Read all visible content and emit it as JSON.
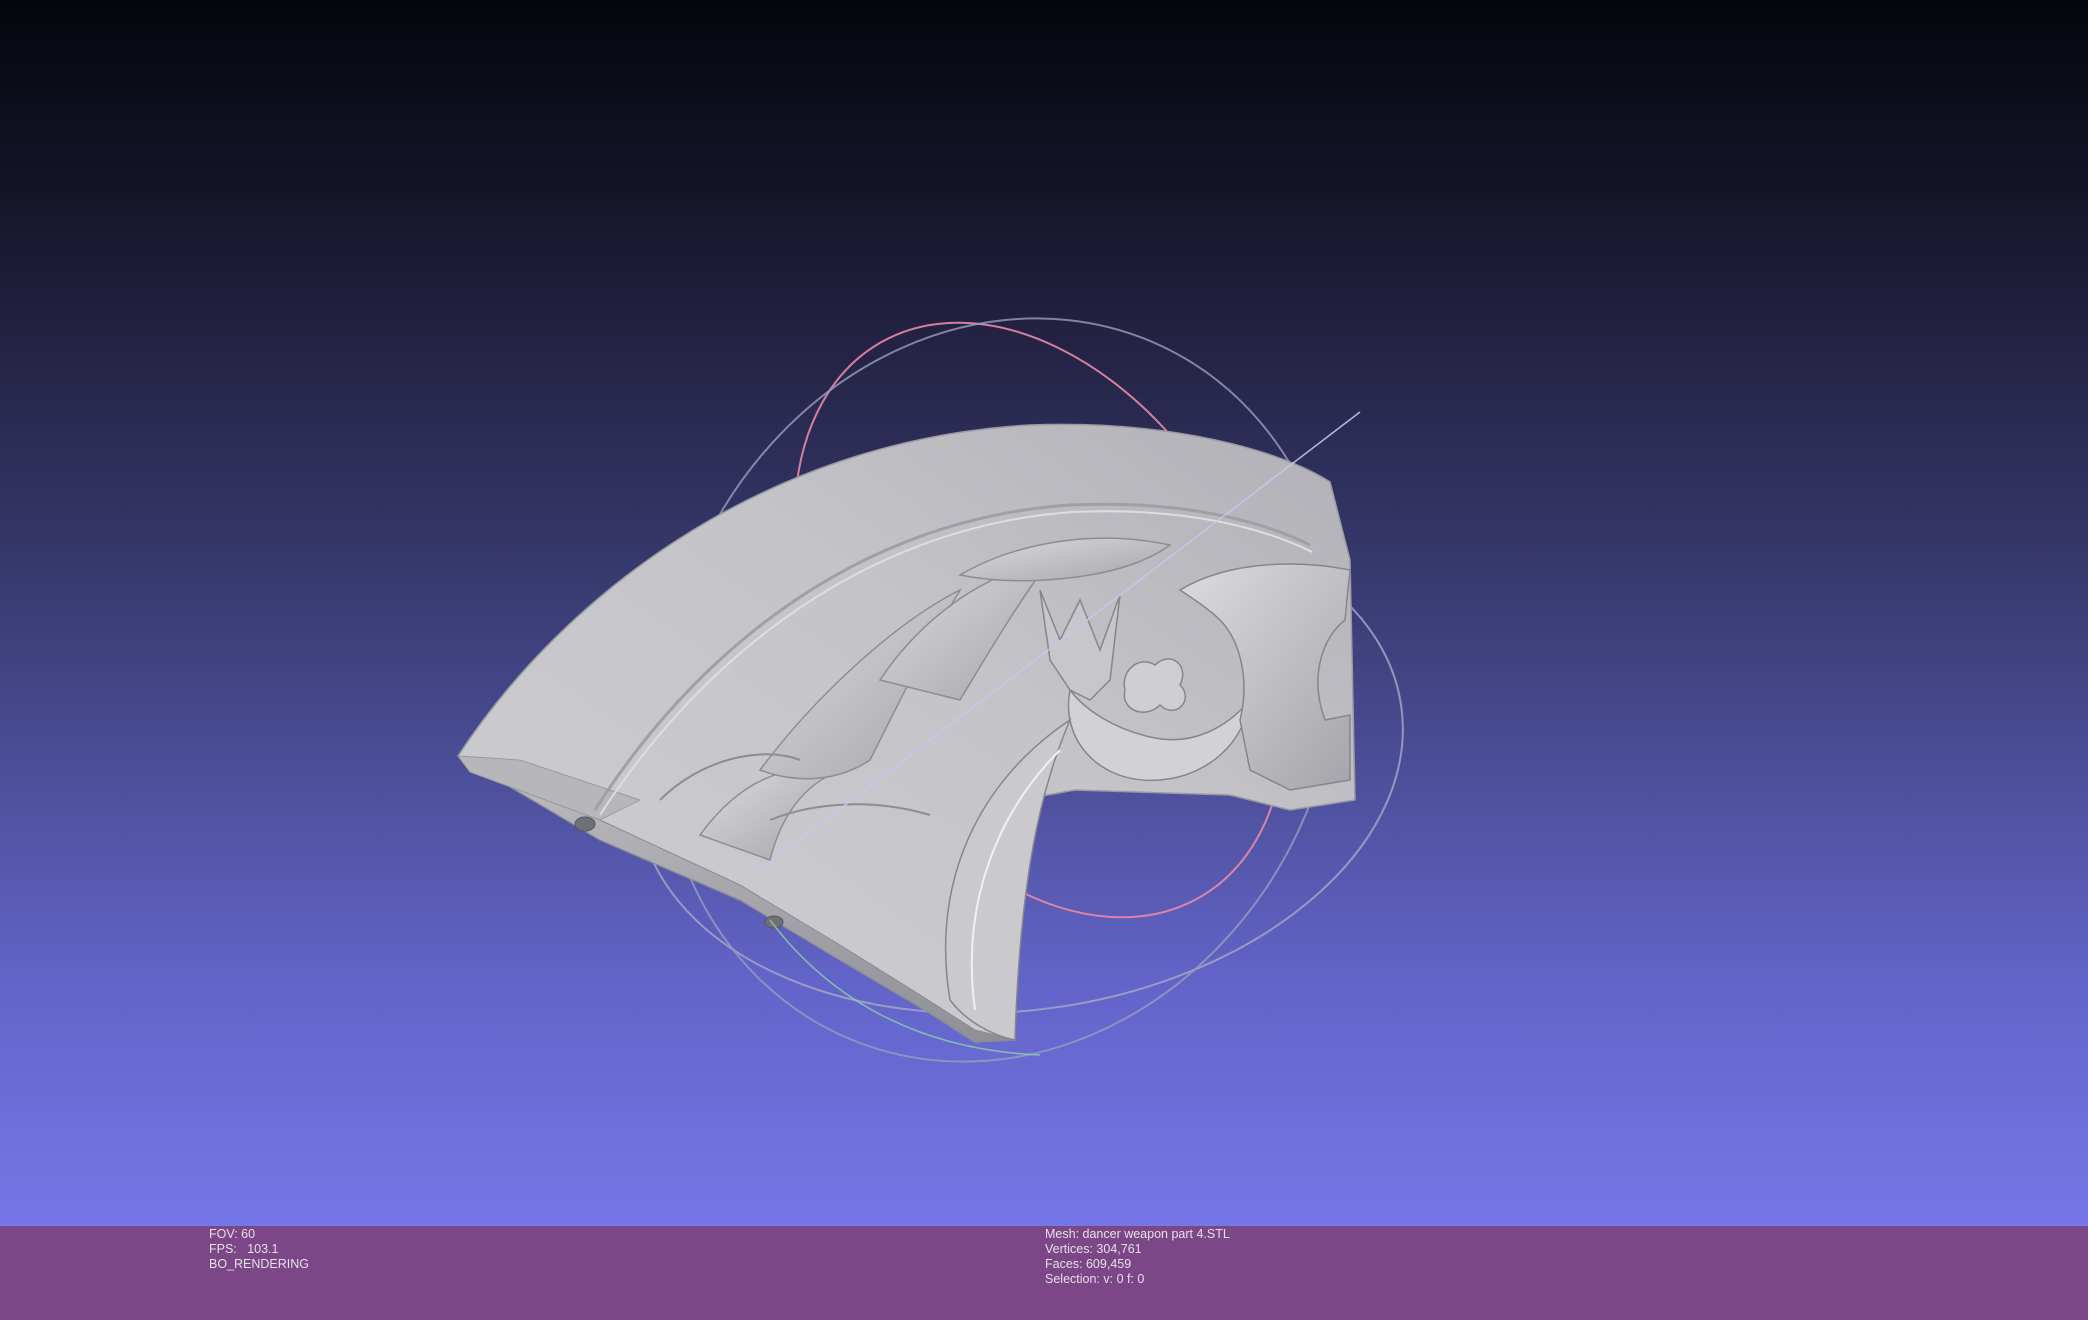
{
  "window": {
    "app": "MeshLab"
  },
  "viewport": {
    "background_top": "#05060c",
    "background_bottom": "#7577e8",
    "mesh_color": "#c8c8cc",
    "trackball_colors": [
      "#e98aa8",
      "#a3a5c7",
      "#8fd0a8"
    ]
  },
  "status_left": {
    "fov": "FOV: 60",
    "fps": "FPS:   103.1",
    "mode": "BO_RENDERING"
  },
  "status_right": {
    "mesh": "Mesh: dancer weapon part 4.STL",
    "vertices": "Vertices: 304,761",
    "faces": "Faces: 609,459",
    "selection": "Selection: v: 0 f: 0"
  },
  "status_bar_color": "#7b4786"
}
